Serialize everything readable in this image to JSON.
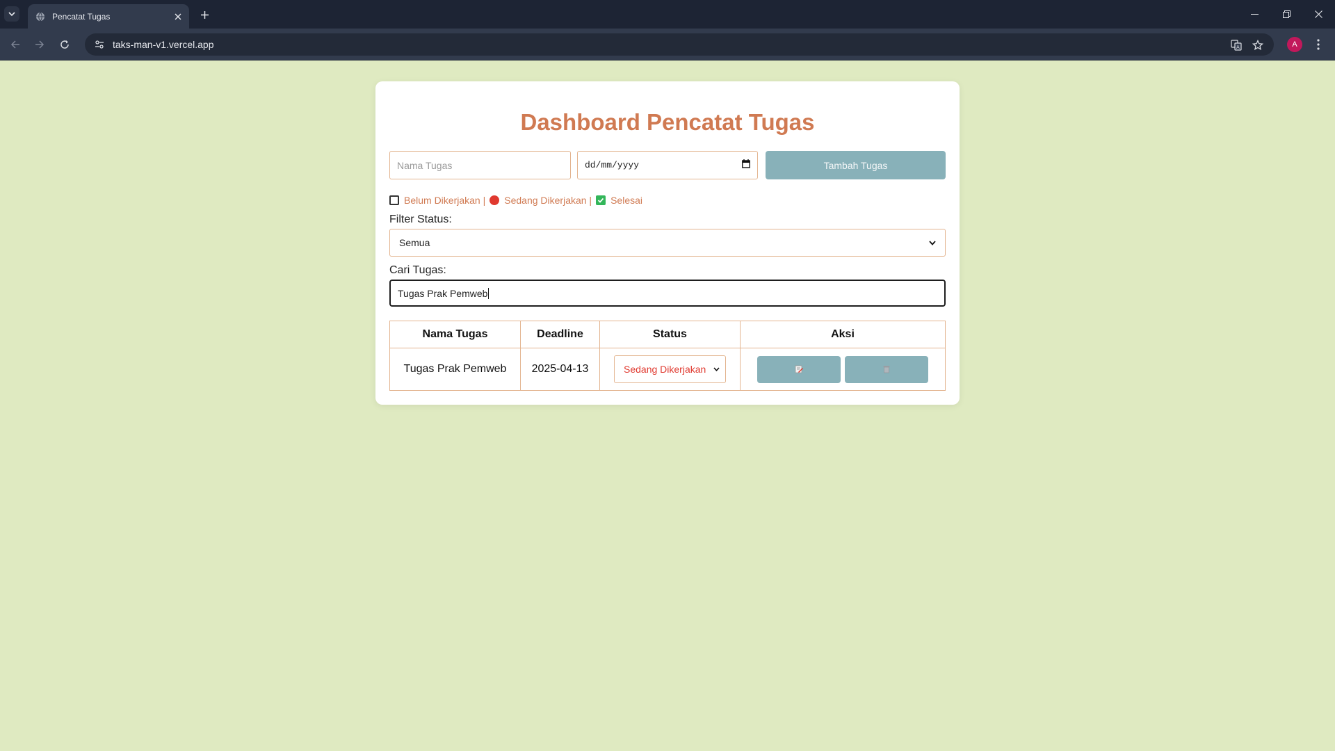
{
  "browser": {
    "tab_title": "Pencatat Tugas",
    "url": "taks-man-v1.vercel.app",
    "profile_initial": "A"
  },
  "page": {
    "title": "Dashboard Pencatat Tugas",
    "form": {
      "nama_placeholder": "Nama Tugas",
      "date_placeholder": "dd/mm/yyyy",
      "add_button": "Tambah Tugas"
    },
    "legend": {
      "belum": "Belum Dikerjakan |",
      "sedang": "Sedang Dikerjakan |",
      "selesai": "Selesai"
    },
    "filter": {
      "label": "Filter Status:",
      "selected": "Semua"
    },
    "search": {
      "label": "Cari Tugas:",
      "value": "Tugas Prak Pemweb"
    },
    "table": {
      "headers": [
        "Nama Tugas",
        "Deadline",
        "Status",
        "Aksi"
      ],
      "rows": [
        {
          "nama": "Tugas Prak Pemweb",
          "deadline": "2025-04-13",
          "status": "Sedang Dikerjakan"
        }
      ]
    }
  },
  "colors": {
    "page_bg": "#dfeac1",
    "accent": "#d07a52",
    "button": "#88b1b9",
    "status_red": "#e0392f",
    "done_green": "#33b65a"
  }
}
